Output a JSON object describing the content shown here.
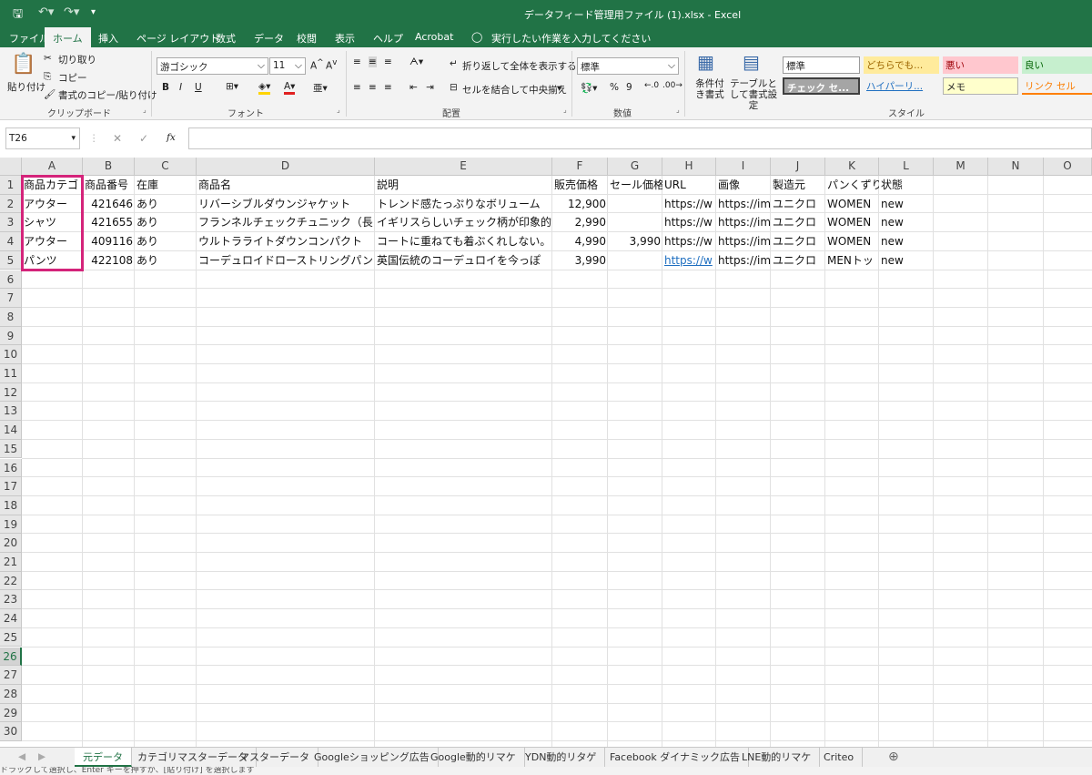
{
  "window": {
    "title": "データフィード管理用ファイル (1).xlsx  -  Excel"
  },
  "ribbon_tabs": [
    "ファイル",
    "ホーム",
    "挿入",
    "ページ レイアウト",
    "数式",
    "データ",
    "校閲",
    "表示",
    "ヘルプ",
    "Acrobat"
  ],
  "tell_me": "実行したい作業を入力してください",
  "clipboard": {
    "paste": "貼り付け",
    "cut": "切り取り",
    "copy": "コピー",
    "format_painter": "書式のコピー/貼り付け",
    "group": "クリップボード"
  },
  "font": {
    "name": "游ゴシック",
    "size": "11",
    "group": "フォント",
    "bold": "B",
    "italic": "I",
    "underline": "U"
  },
  "alignment": {
    "wrap": "折り返して全体を表示する",
    "merge": "セルを結合して中央揃え",
    "group": "配置"
  },
  "number": {
    "format": "標準",
    "percent": "%",
    "comma": "9",
    "group": "数値"
  },
  "styles_group": {
    "conditional": "条件付き書式",
    "table": "テーブルとして書式設定",
    "group": "スタイル",
    "cells": [
      "標準",
      "どちらでも...",
      "悪い",
      "良い",
      "チェック セ...",
      "ハイパーリ...",
      "メモ",
      "リンク セル"
    ]
  },
  "formula_bar": {
    "name_box": "T26",
    "fx": "fx",
    "cancel": "✕",
    "enter": "✓",
    "value": ""
  },
  "columns": [
    "A",
    "B",
    "C",
    "D",
    "E",
    "F",
    "G",
    "H",
    "I",
    "J",
    "K",
    "L",
    "M",
    "N",
    "O"
  ],
  "rows": [
    "1",
    "2",
    "3",
    "4",
    "5",
    "6",
    "7",
    "8",
    "9",
    "10",
    "11",
    "12",
    "13",
    "14",
    "15",
    "16",
    "17",
    "18",
    "19",
    "20",
    "21",
    "22",
    "23",
    "24",
    "25",
    "26",
    "27",
    "28",
    "29",
    "30"
  ],
  "headers": [
    "商品カテゴ",
    "商品番号",
    "在庫",
    "商品名",
    "説明",
    "販売価格",
    "セール価格",
    "URL",
    "画像",
    "製造元",
    "パンくずり",
    "状態"
  ],
  "data_rows": [
    [
      "アウター",
      "421646",
      "あり",
      "リバーシブルダウンジャケット",
      "トレンド感たっぷりなボリューム",
      "12,900",
      "",
      "https://w",
      "https://im",
      "ユニクロ",
      "WOMEN",
      "new"
    ],
    [
      "シャツ",
      "421655",
      "あり",
      "フランネルチェックチュニック（長",
      "イギリスらしいチェック柄が印象的",
      "2,990",
      "",
      "https://w",
      "https://im",
      "ユニクロ",
      "WOMEN",
      "new"
    ],
    [
      "アウター",
      "409116",
      "あり",
      "ウルトラライトダウンコンパクト",
      "コートに重ねても着ぶくれしない。",
      "4,990",
      "3,990",
      "https://w",
      "https://im",
      "ユニクロ",
      "WOMEN",
      "new"
    ],
    [
      "パンツ",
      "422108",
      "あり",
      "コーデュロイドローストリングパン",
      "英国伝統のコーデュロイを今っぽ",
      "3,990",
      "",
      "https://w",
      "https://im",
      "ユニクロ",
      "MENトッ",
      "new"
    ]
  ],
  "sheet_tabs": [
    "元データ",
    "カテゴリマスターデータ",
    "マスターデータ",
    "Googleショッピング広告",
    "Google動的リマケ",
    "YDN動的リタゲ",
    "Facebook ダイナミック広告",
    "LNE動的リマケ",
    "Criteo"
  ],
  "status_text": "ドラッグして選択し、Enter キーを押すか、[貼り付け] を選択します",
  "colors": {
    "accent": "#217346",
    "highlight": "#d4237a",
    "link": "#1f6fc0"
  }
}
